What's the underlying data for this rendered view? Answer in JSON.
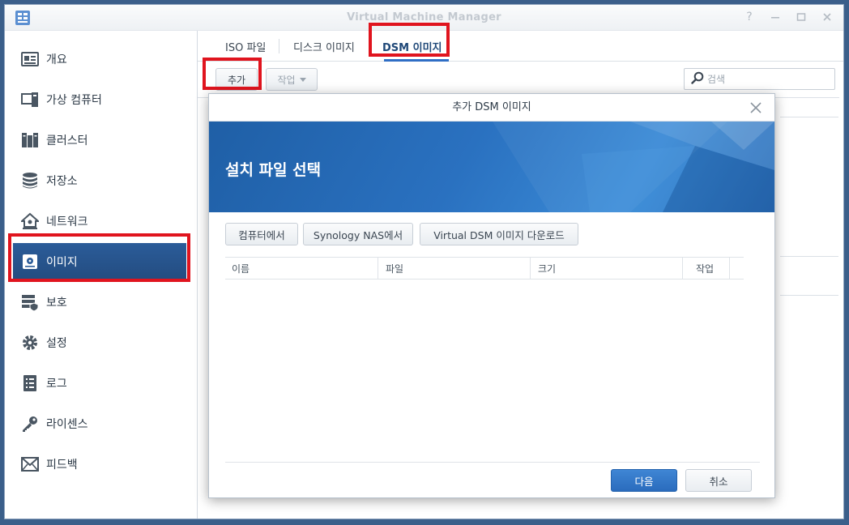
{
  "window": {
    "title": "Virtual Machine Manager"
  },
  "sidebar": {
    "items": [
      {
        "label": "개요",
        "icon": "overview-icon"
      },
      {
        "label": "가상 컴퓨터",
        "icon": "virtual-machine-icon"
      },
      {
        "label": "클러스터",
        "icon": "cluster-icon"
      },
      {
        "label": "저장소",
        "icon": "storage-icon"
      },
      {
        "label": "네트워크",
        "icon": "network-icon"
      },
      {
        "label": "이미지",
        "icon": "image-icon"
      },
      {
        "label": "보호",
        "icon": "protection-icon"
      },
      {
        "label": "설정",
        "icon": "settings-icon"
      },
      {
        "label": "로그",
        "icon": "log-icon"
      },
      {
        "label": "라이센스",
        "icon": "license-icon"
      },
      {
        "label": "피드백",
        "icon": "feedback-icon"
      }
    ],
    "active_index": 5
  },
  "tabs": [
    {
      "label": "ISO 파일"
    },
    {
      "label": "디스크 이미지"
    },
    {
      "label": "DSM 이미지"
    }
  ],
  "toolbar": {
    "add_label": "추가",
    "action_label": "작업",
    "search_placeholder": "검색"
  },
  "modal": {
    "title": "추가 DSM 이미지",
    "banner_title": "설치 파일 선택",
    "buttons": {
      "from_computer": "컴퓨터에서",
      "from_nas": "Synology NAS에서",
      "download": "Virtual DSM 이미지 다운로드"
    },
    "columns": [
      "이름",
      "파일",
      "크기",
      "작업"
    ],
    "next_label": "다음",
    "cancel_label": "취소"
  },
  "colors": {
    "accent": "#2a6cbd",
    "highlight": "#e0141e",
    "sidebar_active": "#2b5c99"
  }
}
